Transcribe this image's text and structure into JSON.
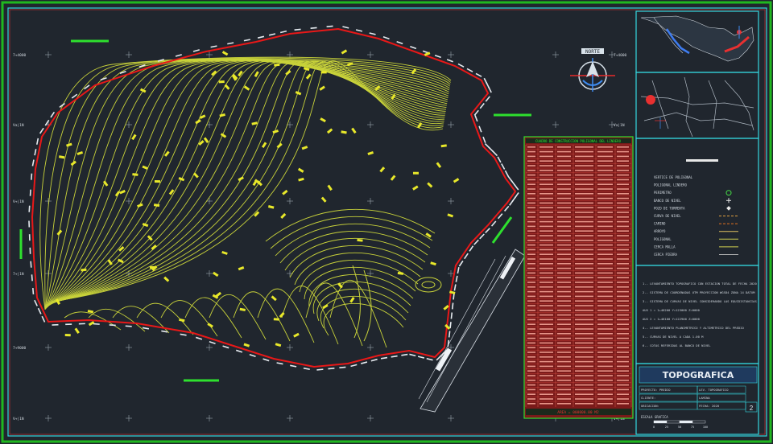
{
  "drawing": {
    "north_label": "NORTE",
    "grid_labels_left": [
      "7+4000",
      "Va|1N",
      "V+|1N",
      "7+|1N",
      "7+9000",
      "V+|1N"
    ],
    "grid_labels_right": [
      "7+4000",
      "Va|1N",
      "V+|1N",
      "7+|1N",
      "7+9000",
      "V+|1N"
    ],
    "table_title": "CUADRO DE CONSTRUCCION POLIGONAL DEL LINDERO",
    "table_footer": "AREA = 000000.00 M2",
    "legend_title": "SIMBOLOGIA",
    "legend_items": [
      {
        "label": "VERTICE DE POLIGONAL",
        "symbol": "none",
        "color": "#c7d2de"
      },
      {
        "label": "POLIGONAL LINDERO",
        "symbol": "none",
        "color": "#c7d2de"
      },
      {
        "label": "PERIMETRO",
        "symbol": "hex",
        "color": "#46e046"
      },
      {
        "label": "BANCO DE NIVEL",
        "symbol": "cross",
        "color": "#e8e8e8"
      },
      {
        "label": "POZO DE TORMENTA",
        "symbol": "diamond",
        "color": "#e8e8e8"
      },
      {
        "label": "CURVA DE NIVEL",
        "symbol": "dash",
        "color": "#e0a040"
      },
      {
        "label": "CAMINO",
        "symbol": "dash",
        "color": "#e07020"
      },
      {
        "label": "ARROYO",
        "symbol": "line",
        "color": "#e0c060"
      },
      {
        "label": "POLIGONAL",
        "symbol": "line",
        "color": "#d0d050"
      },
      {
        "label": "CERCA MALLA",
        "symbol": "line",
        "color": "#d0d050"
      },
      {
        "label": "CERCA PIEDRA",
        "symbol": "line",
        "color": "#b0b0b0"
      }
    ],
    "notes": [
      "1.- LEVANTAMIENTO TOPOGRAFICO CON ESTACION TOTAL DE FECHA 2020",
      "2.- SISTEMA DE COORDENADAS UTM PROYECCION WGS84 ZONA 14 DATUM",
      "3.- SISTEMA DE CURVAS DE NIVEL CONSIDERANDO LAS EQUIDISTANCIAS",
      "AUX 1 = 1+46200  Y=123000  Z=0000",
      "AUX 2 = 1+46100  Y=122900  Z=0000",
      "4.- LEVANTAMIENTO PLANIMETRICO Y ALTIMETRICO DEL PREDIO",
      "5.- CURVAS DE NIVEL A CADA 1.00 M",
      "6.- COTAS REFERIDAS AL BANCO DE NIVEL"
    ],
    "title_block_title": "TOPOGRAFICA",
    "title_block_rows": [
      {
        "left": "PROYECTO: PREDIO",
        "right": "LEV. TOPOGRAFICO"
      },
      {
        "left": "CLIENTE:",
        "right": "LAMINA"
      },
      {
        "left": "UBICACION:",
        "right": "FECHA: 2020"
      }
    ],
    "sheet_number": "2",
    "scale_label": "ESCALA GRAFICA",
    "stroke_labels": [
      "0",
      "25",
      "50",
      "75",
      "100"
    ]
  },
  "colors": {
    "background": "#20262e",
    "border": "#34d8e0",
    "contour": "#c8d23a",
    "boundary": "#e81818",
    "label": "#e8e82a",
    "table": "#d8463c",
    "green": "#2ee02e"
  }
}
